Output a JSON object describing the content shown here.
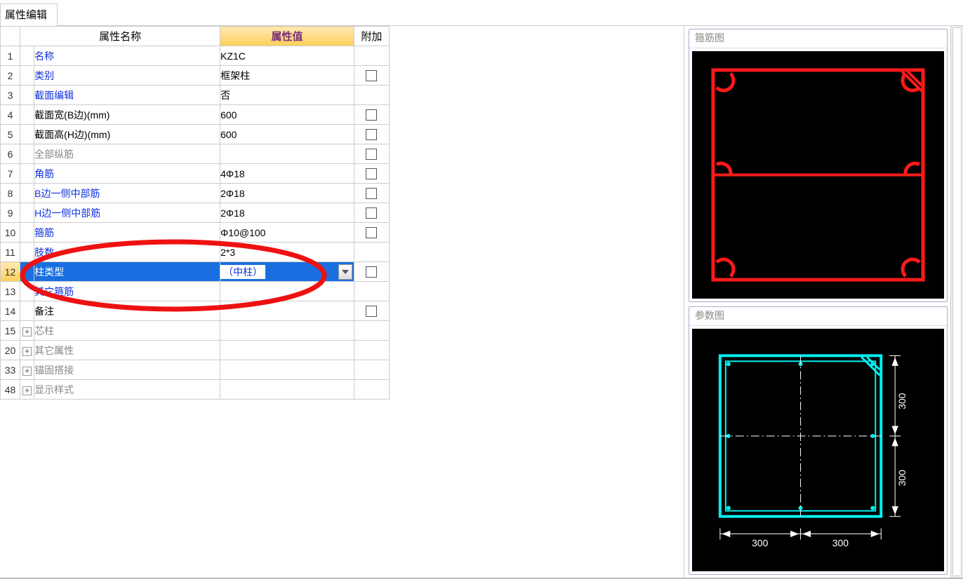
{
  "tab_title": "属性编辑",
  "headers": {
    "name": "属性名称",
    "value": "属性值",
    "addon": "附加"
  },
  "selected_row_idx": 12,
  "rows": [
    {
      "idx": "1",
      "name": "名称",
      "value": "KZ1C",
      "nameClass": "blue",
      "checkbox": false
    },
    {
      "idx": "2",
      "name": "类别",
      "value": "框架柱",
      "nameClass": "blue",
      "checkbox": true
    },
    {
      "idx": "3",
      "name": "截面编辑",
      "value": "否",
      "nameClass": "blue",
      "checkbox": false
    },
    {
      "idx": "4",
      "name": "截面宽(B边)(mm)",
      "value": "600",
      "nameClass": "black",
      "checkbox": true
    },
    {
      "idx": "5",
      "name": "截面高(H边)(mm)",
      "value": "600",
      "nameClass": "black",
      "checkbox": true
    },
    {
      "idx": "6",
      "name": "全部纵筋",
      "value": "",
      "nameClass": "muted",
      "checkbox": true
    },
    {
      "idx": "7",
      "name": "角筋",
      "value": "4Φ18",
      "nameClass": "blue",
      "checkbox": true
    },
    {
      "idx": "8",
      "name": "B边一侧中部筋",
      "value": "2Φ18",
      "nameClass": "blue",
      "checkbox": true
    },
    {
      "idx": "9",
      "name": "H边一侧中部筋",
      "value": "2Φ18",
      "nameClass": "blue",
      "checkbox": true
    },
    {
      "idx": "10",
      "name": "箍筋",
      "value": "Φ10@100",
      "nameClass": "blue",
      "checkbox": true
    },
    {
      "idx": "11",
      "name": "肢数",
      "value": "2*3",
      "nameClass": "blue",
      "checkbox": false
    },
    {
      "idx": "12",
      "name": "柱类型",
      "value": "（中柱）",
      "nameClass": "blue",
      "checkbox": true,
      "dropdown": true,
      "selected": true
    },
    {
      "idx": "13",
      "name": "其它箍筋",
      "value": "",
      "nameClass": "blue",
      "checkbox": false
    },
    {
      "idx": "14",
      "name": "备注",
      "value": "",
      "nameClass": "black",
      "checkbox": true
    },
    {
      "idx": "15",
      "name": "芯柱",
      "value": "",
      "nameClass": "muted",
      "expand": true,
      "checkbox": false
    },
    {
      "idx": "20",
      "name": "其它属性",
      "value": "",
      "nameClass": "muted",
      "expand": true,
      "checkbox": false
    },
    {
      "idx": "33",
      "name": "锚固搭接",
      "value": "",
      "nameClass": "muted",
      "expand": true,
      "checkbox": false
    },
    {
      "idx": "48",
      "name": "显示样式",
      "value": "",
      "nameClass": "muted",
      "expand": true,
      "checkbox": false
    }
  ],
  "right": {
    "panel1_title": "箍筋图",
    "panel2_title": "参数图",
    "dims": {
      "d1": "300",
      "d2": "300",
      "d3": "300",
      "d4": "300"
    }
  }
}
